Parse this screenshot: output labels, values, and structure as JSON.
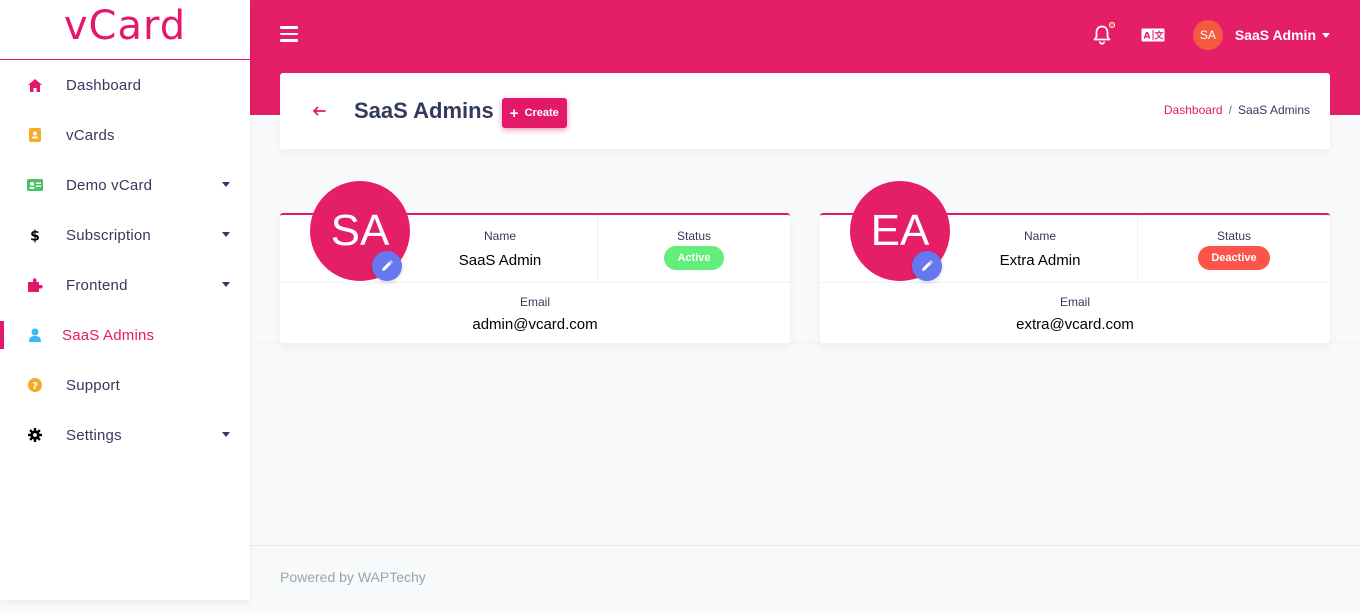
{
  "brand": {
    "name": "vCard"
  },
  "sidebar": {
    "items": [
      {
        "label": "Dashboard",
        "icon": "home-icon",
        "color": "#e4186b",
        "caret": false,
        "active": false
      },
      {
        "label": "vCards",
        "icon": "vcard-icon",
        "color": "#f7a928",
        "caret": false,
        "active": false
      },
      {
        "label": "Demo vCard",
        "icon": "id-card-icon",
        "color": "#47c363",
        "caret": true,
        "active": false
      },
      {
        "label": "Subscription",
        "icon": "dollar-icon",
        "color": "#000000",
        "caret": true,
        "active": false
      },
      {
        "label": "Frontend",
        "icon": "puzzle-icon",
        "color": "#e4186b",
        "caret": true,
        "active": false
      },
      {
        "label": "SaaS Admins",
        "icon": "user-icon",
        "color": "#3abaf4",
        "caret": false,
        "active": true
      },
      {
        "label": "Support",
        "icon": "question-circle-icon",
        "color": "#f7a928",
        "caret": false,
        "active": false
      },
      {
        "label": "Settings",
        "icon": "gear-icon",
        "color": "#000000",
        "caret": true,
        "active": false
      }
    ]
  },
  "navbar": {
    "user_initials": "SA",
    "user_name": "SaaS Admin"
  },
  "header": {
    "title": "SaaS Admins",
    "create_label": "Create",
    "breadcrumb": {
      "home": "Dashboard",
      "current": "SaaS Admins"
    }
  },
  "labels": {
    "name": "Name",
    "status": "Status",
    "email": "Email"
  },
  "admins": [
    {
      "initials": "SA",
      "name": "SaaS Admin",
      "status": "Active",
      "status_color": "#63ed7a",
      "email": "admin@vcard.com"
    },
    {
      "initials": "EA",
      "name": "Extra Admin",
      "status": "Deactive",
      "status_color": "#fc544b",
      "email": "extra@vcard.com"
    }
  ],
  "footer": {
    "text": "Powered by WAPTechy"
  },
  "colors": {
    "primary": "#e4186b",
    "edit": "#6777ef"
  }
}
